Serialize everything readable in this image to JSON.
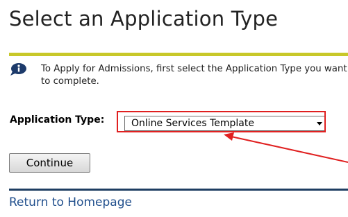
{
  "page": {
    "title": "Select an Application Type"
  },
  "info": {
    "icon": "info-speech-bubble-icon",
    "text": "To Apply for Admissions, first select the Application Type you want to complete."
  },
  "form": {
    "application_type_label": "Application Type:",
    "application_type_selected": "Online Services Template",
    "continue_label": "Continue"
  },
  "footer": {
    "return_link": "Return to Homepage"
  },
  "colors": {
    "title_rule": "#c8c82a",
    "bottom_rule": "#1e3e62",
    "link": "#1f4e8c",
    "annotation": "#e02020"
  }
}
